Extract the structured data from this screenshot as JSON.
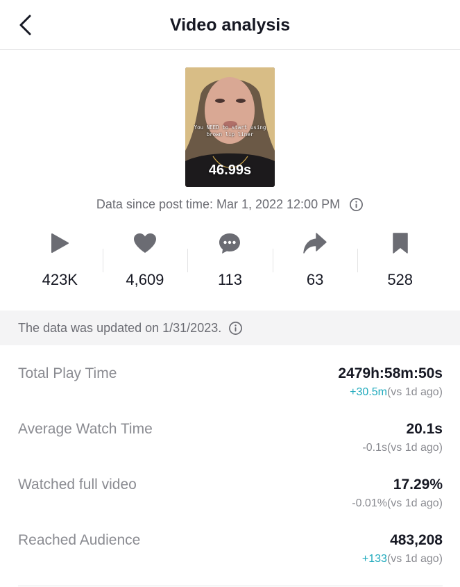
{
  "header": {
    "title": "Video analysis"
  },
  "video": {
    "caption": "You NEED to start using brown lip liner",
    "duration": "46.99s"
  },
  "post_time": {
    "text": "Data since post time: Mar 1, 2022 12:00 PM"
  },
  "stats": {
    "plays": "423K",
    "likes": "4,609",
    "comments": "113",
    "shares": "63",
    "saves": "528"
  },
  "notice": {
    "text": "The data was updated on 1/31/2023."
  },
  "metrics": {
    "total_play_time": {
      "label": "Total Play Time",
      "value": "2479h:58m:50s",
      "delta": "+30.5m",
      "compare": "(vs 1d ago)"
    },
    "avg_watch_time": {
      "label": "Average Watch Time",
      "value": "20.1s",
      "delta": "-0.1s",
      "compare": "(vs 1d ago)"
    },
    "watched_full": {
      "label": "Watched full video",
      "value": "17.29%",
      "delta": "-0.01%",
      "compare": "(vs 1d ago)"
    },
    "reached_audience": {
      "label": "Reached Audience",
      "value": "483,208",
      "delta": "+133",
      "compare": "(vs 1d ago)"
    }
  },
  "colors": {
    "text": "#161823",
    "muted": "#8a8b91",
    "positive": "#20aabd",
    "icon": "#6b6c73",
    "notice_bg": "#f4f4f5"
  }
}
